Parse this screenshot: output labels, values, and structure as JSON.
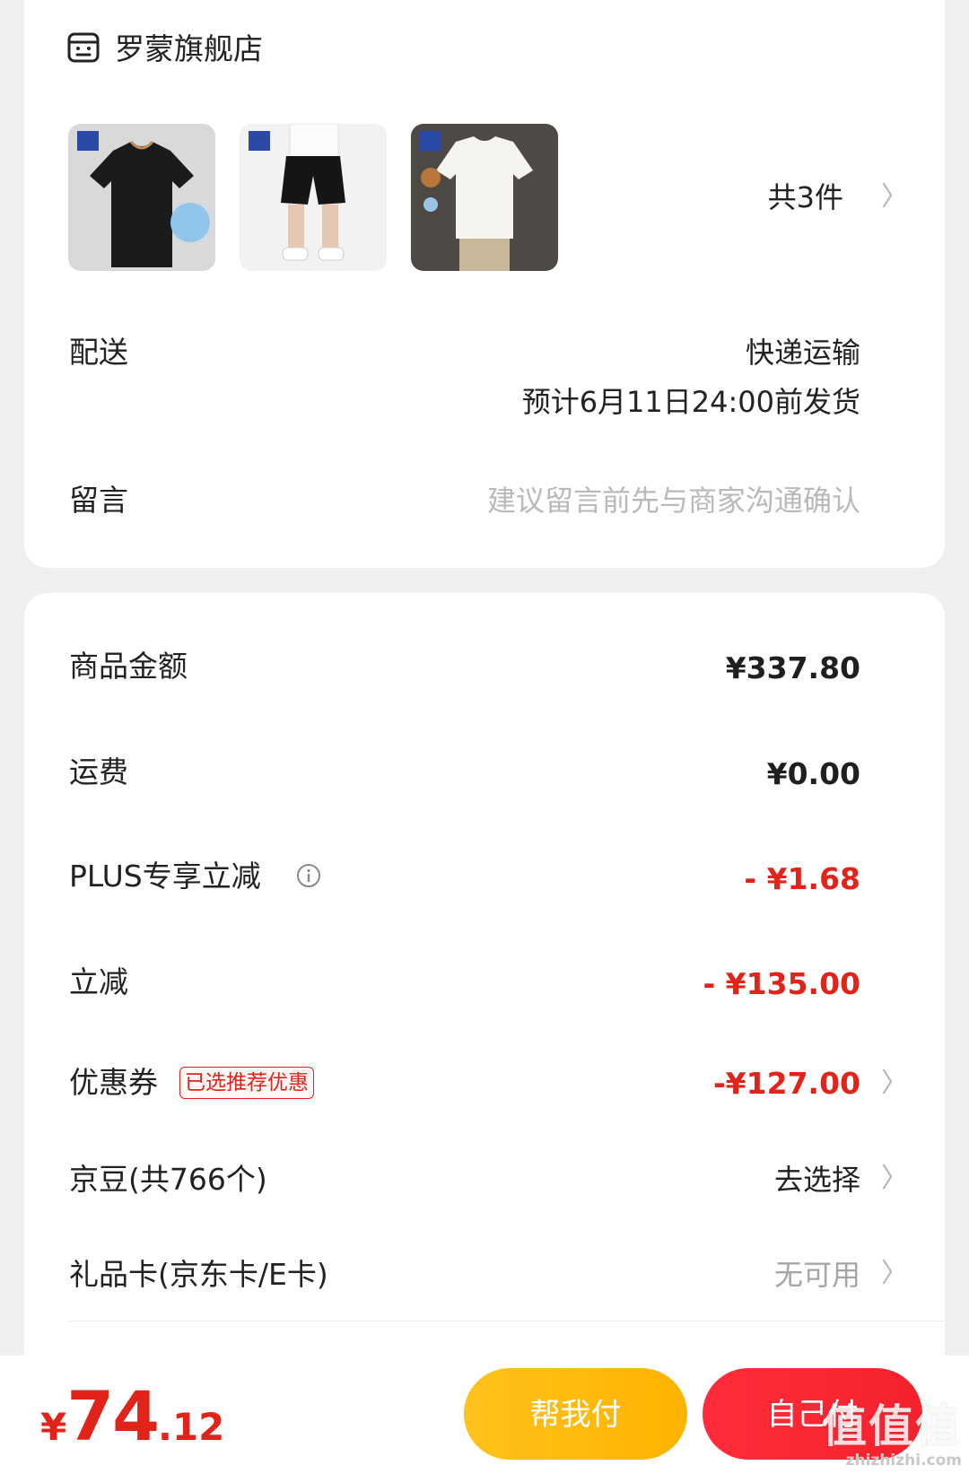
{
  "store": {
    "name": "罗蒙旗舰店",
    "icon": "store-icon",
    "item_count": "共3件",
    "thumbnails": [
      {
        "name": "black-polo-shirt",
        "brand": "罗蒙"
      },
      {
        "name": "black-shorts",
        "brand": "罗蒙"
      },
      {
        "name": "white-tshirt",
        "brand": "罗蒙"
      }
    ]
  },
  "delivery": {
    "label": "配送",
    "method": "快递运输",
    "eta": "预计6月11日24:00前发货"
  },
  "message": {
    "label": "留言",
    "placeholder": "建议留言前先与商家沟通确认"
  },
  "amounts": {
    "goods_label": "商品金额",
    "goods_value": "¥337.80",
    "shipping_label": "运费",
    "shipping_value": "¥0.00",
    "plus_label": "PLUS专享立减",
    "plus_value": "- ¥1.68",
    "discount_label": "立减",
    "discount_value": "- ¥135.00",
    "coupon_label": "优惠券",
    "coupon_badge": "已选推荐优惠",
    "coupon_value": "-¥127.00",
    "beans_label": "京豆(共766个)",
    "beans_value": "去选择",
    "giftcard_label": "礼品卡(京东卡/E卡)",
    "giftcard_value": "无可用"
  },
  "footer": {
    "currency": "¥",
    "total_int": "74",
    "total_dec": ".12",
    "help_pay": "帮我付",
    "self_pay": "自己付"
  },
  "watermark": {
    "big": "值值值",
    "small": "zhizhizhi.com"
  },
  "colors": {
    "accent_red": "#e2231a",
    "help_button": "#ffb300",
    "self_button": "#f5222d"
  }
}
